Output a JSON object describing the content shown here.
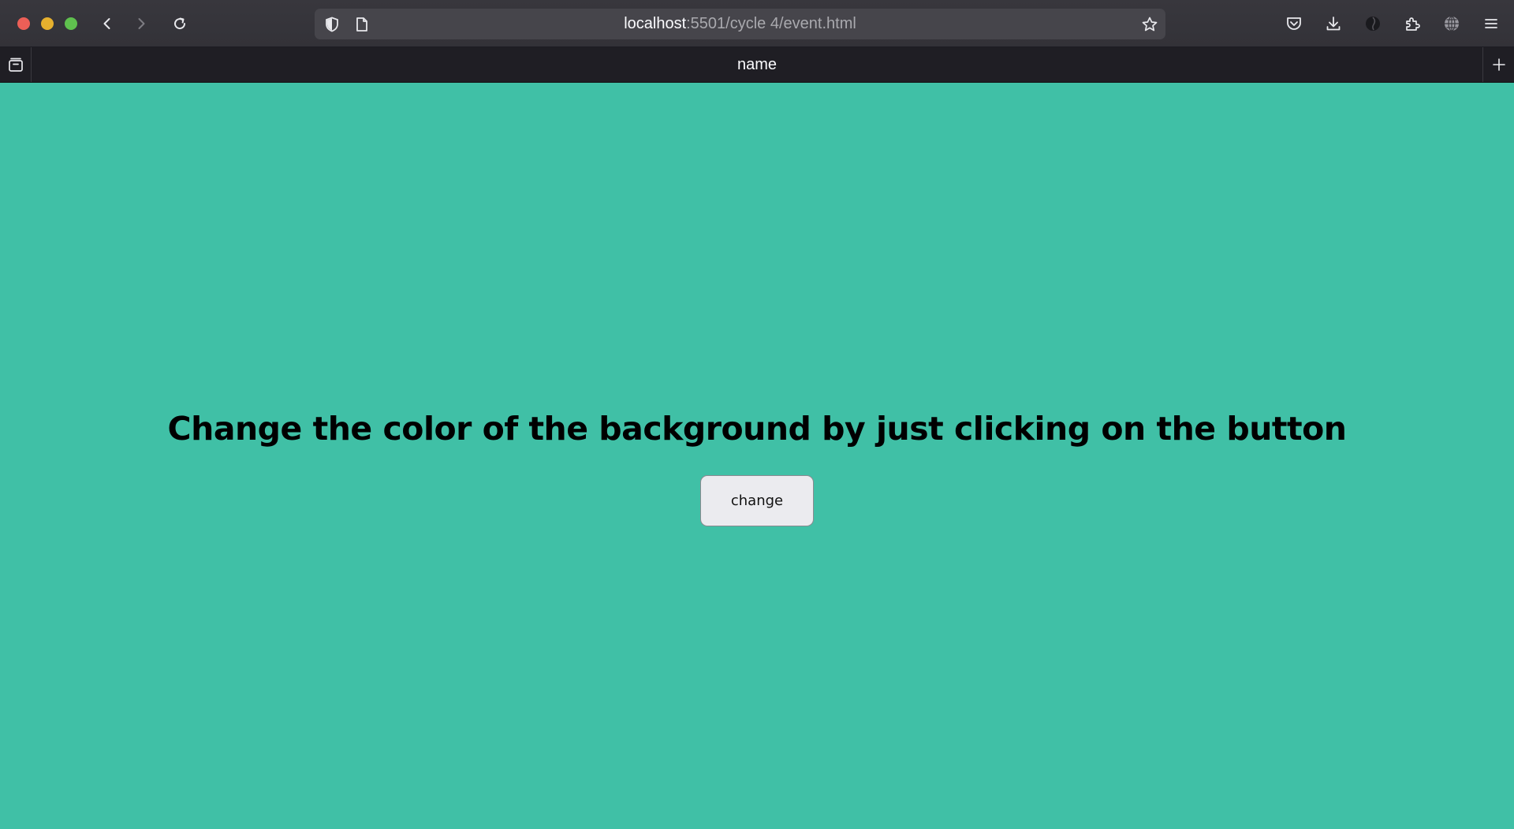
{
  "browser": {
    "url_host": "localhost",
    "url_rest": ":5501/cycle 4/event.html",
    "tab_title": "name"
  },
  "toolbar_icons": [
    "back-icon",
    "forward-icon",
    "reload-icon",
    "shield-icon",
    "page-icon",
    "star-icon",
    "pocket-icon",
    "download-icon",
    "account-icon",
    "extensions-icon",
    "globe-icon",
    "menu-icon"
  ],
  "colors": {
    "page_background": "#40c0a6",
    "button_background": "#ebebef"
  },
  "page": {
    "heading": "Change the color of the background by just clicking on the button",
    "button_label": "change"
  }
}
